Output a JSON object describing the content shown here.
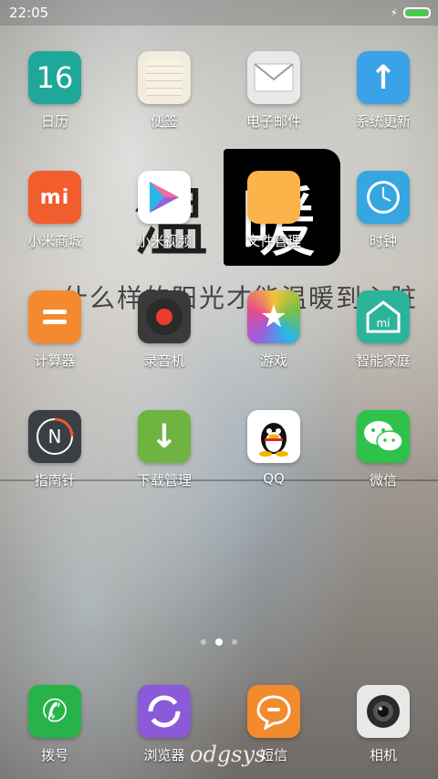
{
  "status_bar": {
    "time": "22:05",
    "battery_level": 1.0,
    "charging": true,
    "battery_color": "#3bd33b"
  },
  "watermark": {
    "char1": "温",
    "char2": "暖",
    "tagline": "什么样的阳光才能温暖到心脏"
  },
  "apps": [
    [
      {
        "name": "日历",
        "icon": "calendar-icon",
        "glyph": "16",
        "color": "#1fa89a"
      },
      {
        "name": "便签",
        "icon": "notes-icon",
        "glyph": "",
        "color": "#f2ecdc"
      },
      {
        "name": "电子邮件",
        "icon": "mail-icon",
        "glyph": "",
        "color": "#e9e9e9"
      },
      {
        "name": "系统更新",
        "icon": "update-arrow-icon",
        "glyph": "↑",
        "color": "#3aa2e6"
      }
    ],
    [
      {
        "name": "小米商城",
        "icon": "mi-store-icon",
        "glyph": "mi",
        "color": "#f25d2e"
      },
      {
        "name": "小米视频",
        "icon": "video-play-icon",
        "glyph": "",
        "color": "#ffffff"
      },
      {
        "name": "文件管理",
        "icon": "folder-icon",
        "glyph": "",
        "color": "#fbb44a"
      },
      {
        "name": "时钟",
        "icon": "clock-icon",
        "glyph": "",
        "color": "#35a6df"
      }
    ],
    [
      {
        "name": "计算器",
        "icon": "calculator-icon",
        "glyph": "=",
        "color": "#f5892e"
      },
      {
        "name": "录音机",
        "icon": "recorder-icon",
        "glyph": "●",
        "color": "#3a3a3a"
      },
      {
        "name": "游戏",
        "icon": "star-game-icon",
        "glyph": "★",
        "color": "#e54b8c"
      },
      {
        "name": "智能家庭",
        "icon": "smart-home-icon",
        "glyph": "mi",
        "color": "#2bb49a"
      }
    ],
    [
      {
        "name": "指南针",
        "icon": "compass-icon",
        "glyph": "N",
        "color": "#3b3f44"
      },
      {
        "name": "下载管理",
        "icon": "download-icon",
        "glyph": "↓",
        "color": "#6fb440"
      },
      {
        "name": "QQ",
        "icon": "qq-penguin-icon",
        "glyph": "🐧",
        "color": "#ffffff"
      },
      {
        "name": "微信",
        "icon": "wechat-icon",
        "glyph": "",
        "color": "#2ec24a"
      }
    ]
  ],
  "page_indicator": {
    "count": 3,
    "active": 1
  },
  "dock": [
    {
      "name": "拨号",
      "icon": "phone-icon",
      "glyph": "✆",
      "color": "#27b34a"
    },
    {
      "name": "浏览器",
      "icon": "browser-icon",
      "glyph": "",
      "color": "#8a5ad8"
    },
    {
      "name": "短信",
      "icon": "message-icon",
      "glyph": "",
      "color": "#f28a2e"
    },
    {
      "name": "相机",
      "icon": "camera-icon",
      "glyph": "",
      "color": "#e8e8e8"
    }
  ],
  "signature": "odgsys"
}
